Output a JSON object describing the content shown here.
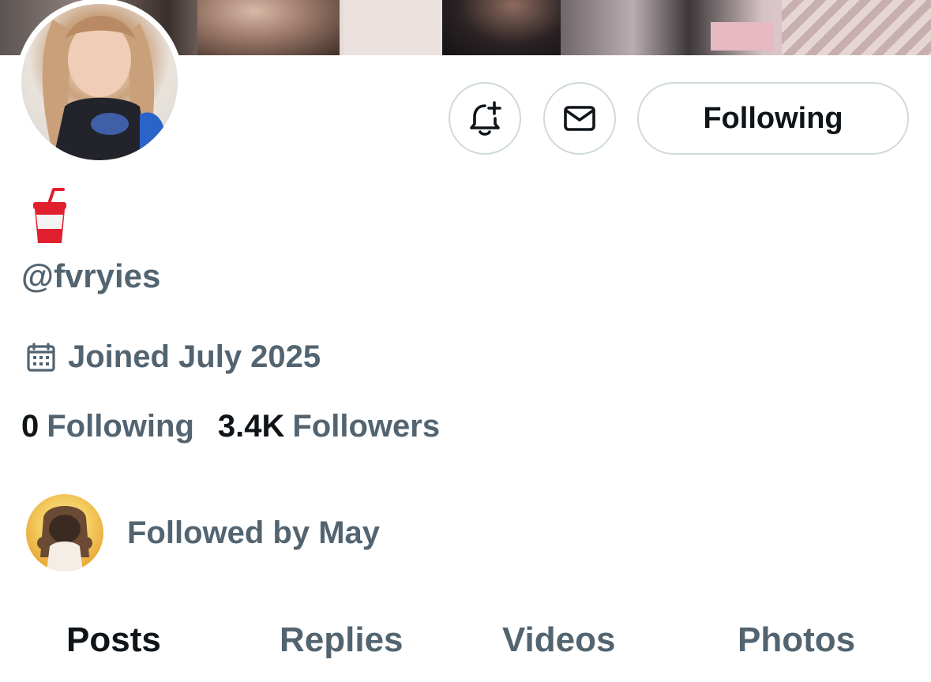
{
  "profile": {
    "display_name_emoji": "🥤",
    "handle": "@fvryies",
    "joined": "Joined July 2025",
    "following_count": "0",
    "following_label": "Following",
    "followers_count": "3.4K",
    "followers_label": "Followers",
    "followed_by": "Followed by May"
  },
  "actions": {
    "notify_icon": "bell-plus-icon",
    "message_icon": "envelope-icon",
    "follow_button_label": "Following"
  },
  "tabs": [
    {
      "label": "Posts",
      "active": true
    },
    {
      "label": "Replies",
      "active": false
    },
    {
      "label": "Videos",
      "active": false
    },
    {
      "label": "Photos",
      "active": false
    }
  ],
  "colors": {
    "primary_text": "#0f1419",
    "secondary_text": "#536471",
    "border": "#cfd9de",
    "cup_red": "#e0202e"
  }
}
